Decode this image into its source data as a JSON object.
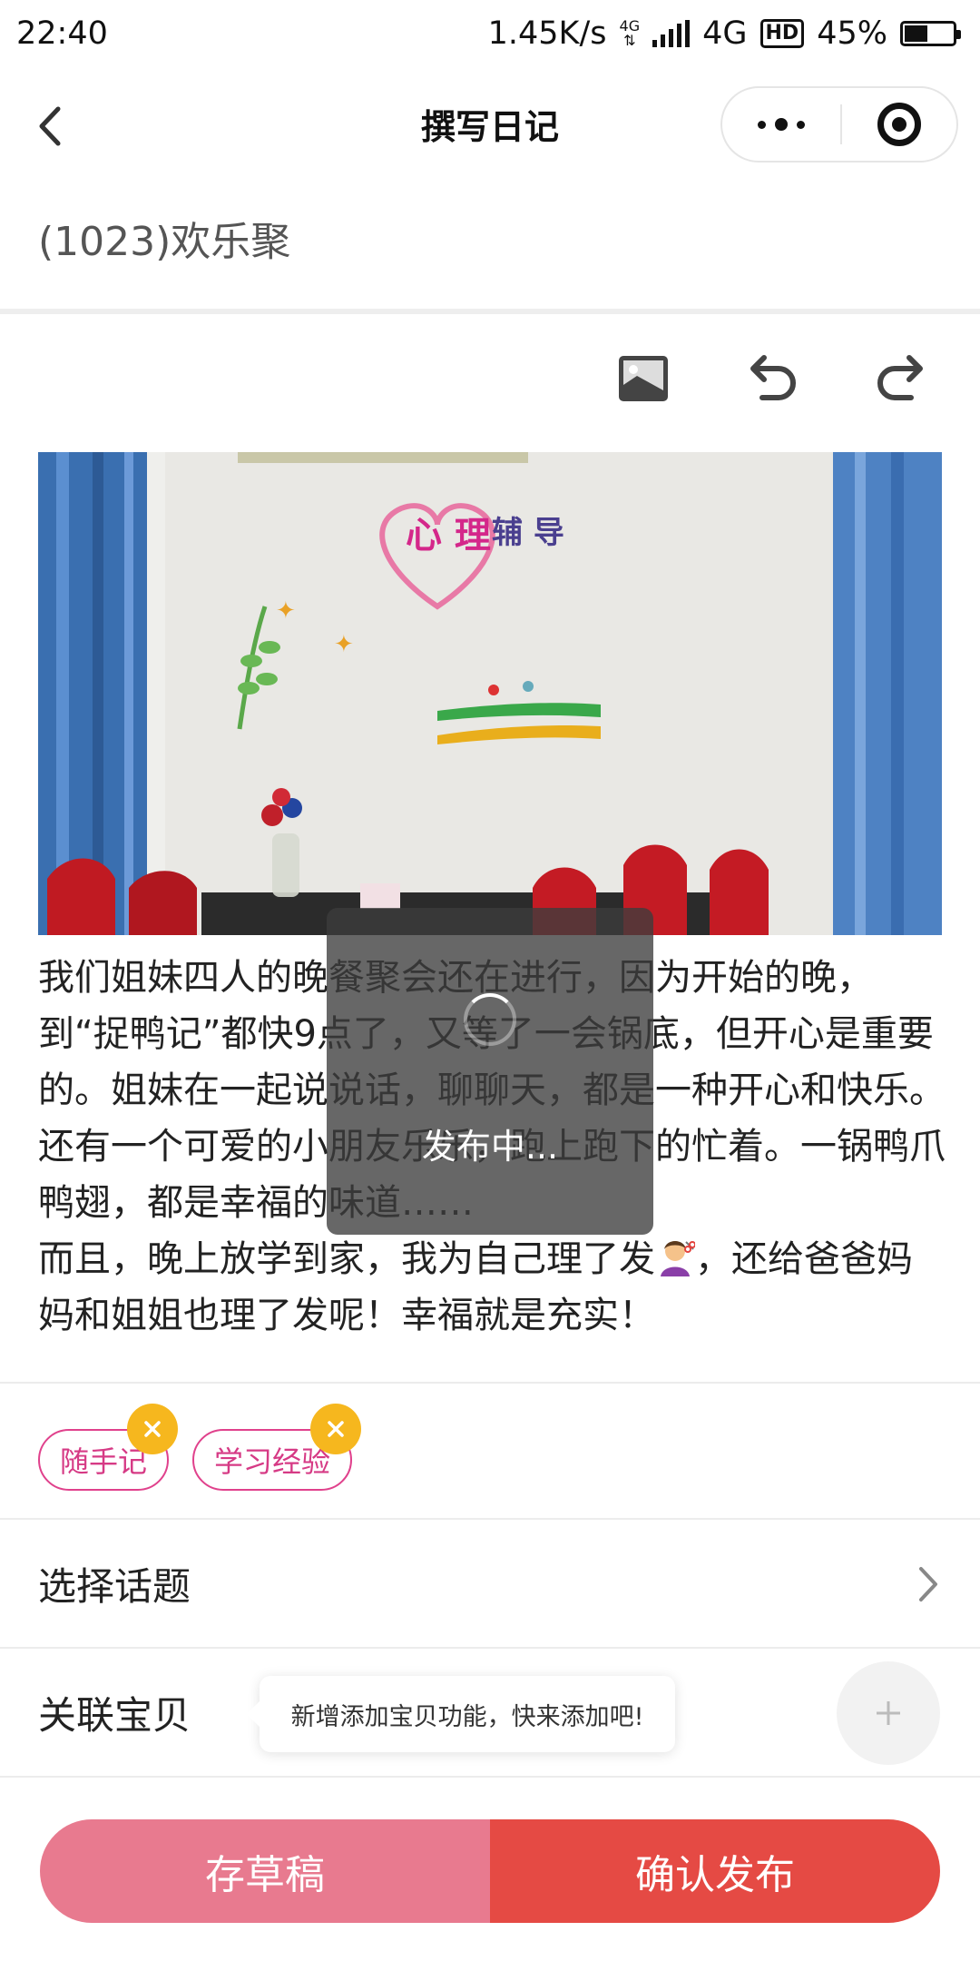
{
  "status_bar": {
    "time": "22:40",
    "speed": "1.45K/s",
    "network_small": "4G",
    "network": "4G",
    "hd": "HD",
    "battery": "45%",
    "battery_level": 0.45
  },
  "nav": {
    "title": "撰写日记"
  },
  "diary": {
    "title": "(1023)欢乐聚",
    "text_part1": "我们姐妹四人的晚餐聚会还在进行，因为开始的晚，到“捉鸭记”都快9点了，又等了一会锅底，但开心是重要的。姐妹在一起说说话，聊聊天，都是一种开心和快乐。还有一个可爱的小朋友乐乐，跑上跑下的忙着。一锅鸭爪鸭翅，都是幸福的味道……",
    "text_part2": "而且，晚上放学到家，我为自己理了发",
    "text_part3": "，还给爸爸妈妈和姐姐也理了发呢！幸福就是充实！",
    "emoji_icon": "haircut-emoji",
    "photo_text_1": "心 理",
    "photo_text_2": "辅 导"
  },
  "toolbar": {
    "icons": [
      "image-icon",
      "undo-icon",
      "redo-icon"
    ]
  },
  "loading": {
    "text": "发布中..."
  },
  "tags": [
    {
      "label": "随手记"
    },
    {
      "label": "学习经验"
    }
  ],
  "rows": {
    "topic_label": "选择话题",
    "link_label": "关联宝贝",
    "tooltip": "新增添加宝贝功能，快来添加吧!"
  },
  "buttons": {
    "draft": "存草稿",
    "publish": "确认发布"
  },
  "colors": {
    "tag_border": "#e0418c",
    "tag_close": "#f6b71e",
    "draft_button": "#e87a8f",
    "publish_button": "#e54a44"
  }
}
